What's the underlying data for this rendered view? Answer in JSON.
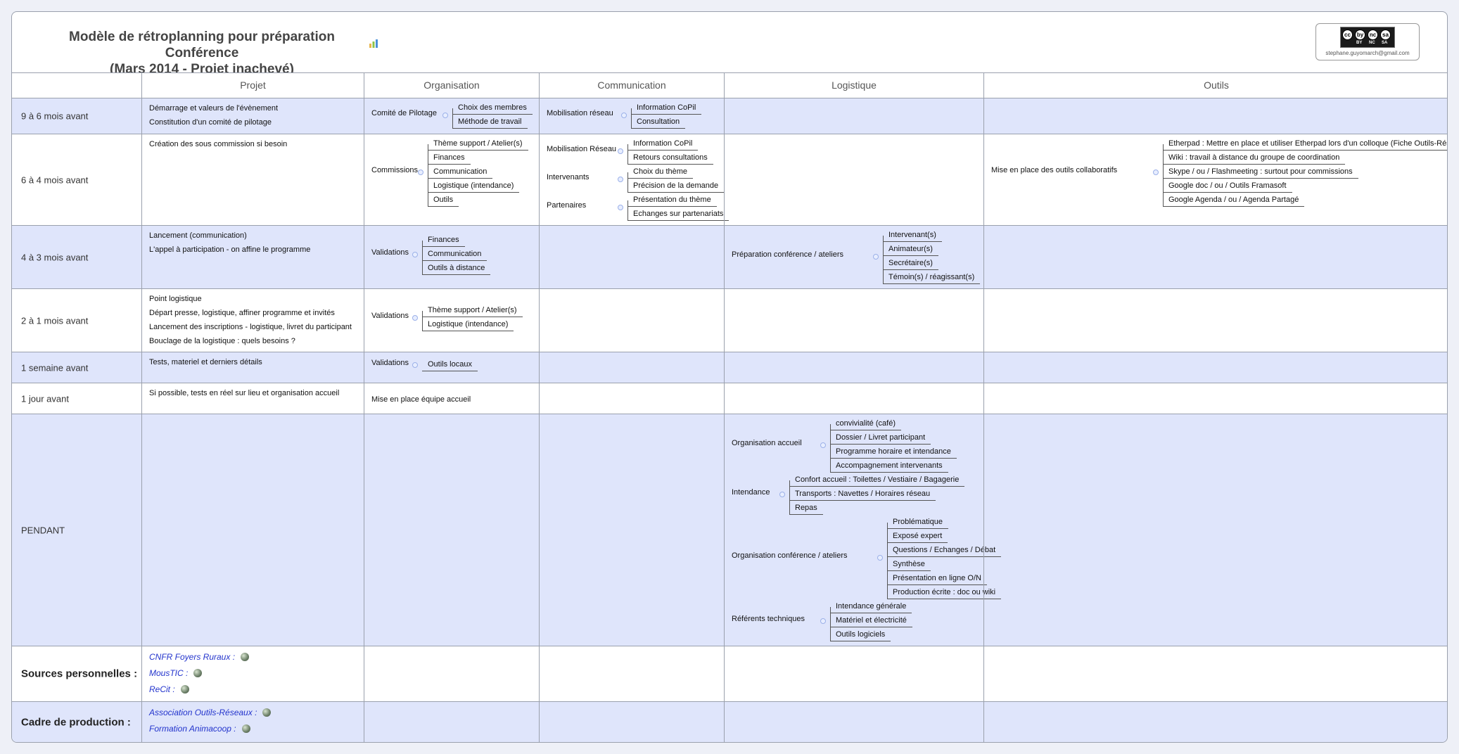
{
  "title": {
    "line1": "Modèle de rétroplanning pour préparation Conférence",
    "line2": "(Mars 2014 - Projet inachevé)"
  },
  "license": {
    "badge": [
      "cc",
      "by",
      "nc",
      "sa"
    ],
    "tags": [
      "BY",
      "NC",
      "SA"
    ],
    "email": "stephane.guyomarch@gmail.com"
  },
  "headers": [
    "",
    "Projet",
    "Organisation",
    "Communication",
    "Logistique",
    "Outils"
  ],
  "rows": [
    {
      "label": "9 à 6 mois avant",
      "projet": [
        "Démarrage et valeurs de l'évènement",
        "Constitution d'un comité de pilotage"
      ],
      "organisation": [
        {
          "parent": "Comité de Pilotage",
          "children": [
            "Choix des membres",
            "Méthode de travail"
          ]
        }
      ],
      "communication": [
        {
          "parent": "Mobilisation réseau",
          "children": [
            "Information CoPil",
            "Consultation"
          ]
        }
      ]
    },
    {
      "label": "6 à 4 mois avant",
      "projet": [
        "Création des sous commission si besoin"
      ],
      "organisation": [
        {
          "parent": "Commissions",
          "children": [
            "Thème support / Atelier(s)",
            "Finances",
            "Communication",
            "Logistique (intendance)",
            "Outils"
          ]
        }
      ],
      "communication": [
        {
          "parent": "Mobilisation Réseau",
          "children": [
            "Information CoPil",
            "Retours consultations"
          ]
        },
        {
          "parent": "Intervenants",
          "children": [
            "Choix du thème",
            "Précision de la demande"
          ]
        },
        {
          "parent": "Partenaires",
          "children": [
            "Présentation du thème",
            "Echanges sur partenariats"
          ]
        }
      ],
      "outils": [
        {
          "parent": "Mise en place des outils collaboratifs",
          "children": [
            "Etherpad : Mettre en place et utiliser Etherpad lors d'un colloque (Fiche Outils-Réseaux)",
            "Wiki : travail à distance du groupe de coordination",
            "Skype / ou / Flashmeeting : surtout pour commissions",
            "Google doc / ou / Outils Framasoft",
            "Google Agenda / ou / Agenda Partagé"
          ]
        }
      ]
    },
    {
      "label": "4 à 3 mois avant",
      "projet": [
        "Lancement (communication)",
        "L'appel à participation - on affine le programme"
      ],
      "organisation": [
        {
          "parent": "Validations",
          "children": [
            "Finances",
            "Communication",
            "Outils à distance"
          ]
        }
      ],
      "logistique": [
        {
          "parent": "Préparation conférence / ateliers",
          "children": [
            "Intervenant(s)",
            "Animateur(s)",
            "Secrétaire(s)",
            "Témoin(s) / réagissant(s)"
          ]
        }
      ]
    },
    {
      "label": "2 à 1 mois avant",
      "projet": [
        "Point logistique",
        "Départ presse, logistique, affiner programme et invités",
        "Lancement des inscriptions - logistique, livret du participant",
        "Bouclage de la logistique : quels besoins ?"
      ],
      "organisation": [
        {
          "parent": "Validations",
          "children": [
            "Thème support / Atelier(s)",
            "Logistique (intendance)"
          ]
        }
      ]
    },
    {
      "label": "1 semaine avant",
      "projet": [
        "Tests, materiel et derniers détails"
      ],
      "organisation": [
        {
          "parent": "Validations",
          "children": [
            "Outils locaux"
          ]
        }
      ]
    },
    {
      "label": "1 jour avant",
      "projet": [
        "Si possible, tests en réel sur lieu et organisation accueil"
      ],
      "organisation_text": "Mise en place équipe accueil"
    },
    {
      "label": "PENDANT",
      "logistique": [
        {
          "parent": "Organisation accueil",
          "children": [
            "convivialité (café)",
            "Dossier / Livret participant",
            "Programme horaire et intendance",
            "Accompagnement intervenants"
          ]
        },
        {
          "parent": "Intendance",
          "children": [
            "Confort accueil : Toilettes / Vestiaire / Bagagerie",
            "Transports : Navettes / Horaires réseau",
            "Repas"
          ]
        },
        {
          "parent": "Organisation conférence / ateliers",
          "children": [
            "Problématique",
            "Exposé expert",
            "Questions / Echanges / Débat",
            "Synthèse",
            "Présentation en ligne O/N",
            "Production écrite : doc ou wiki"
          ]
        },
        {
          "parent": "Référents techniques",
          "children": [
            "Intendance générale",
            "Matériel et électricité",
            "Outils logiciels"
          ]
        }
      ]
    },
    {
      "label": "Sources personnelles :",
      "links": [
        "CNFR Foyers Ruraux :",
        "MousTIC :",
        "ReCit :"
      ]
    },
    {
      "label": "Cadre de production :",
      "links": [
        "Association Outils-Réseaux :",
        "Formation Animacoop :"
      ]
    }
  ]
}
